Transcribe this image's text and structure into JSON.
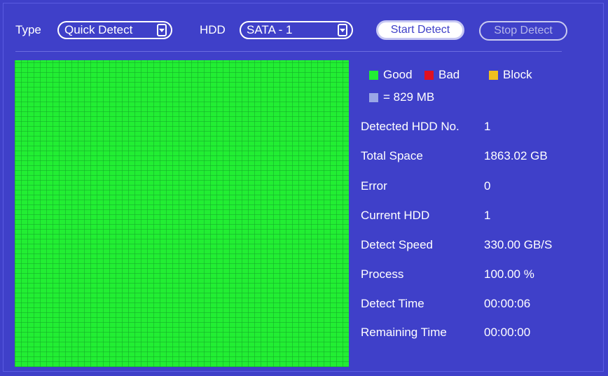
{
  "toolbar": {
    "type_label": "Type",
    "type_value": "Quick Detect",
    "hdd_label": "HDD",
    "hdd_value": "SATA - 1",
    "start_label": "Start Detect",
    "stop_label": "Stop Detect"
  },
  "legend": {
    "good": "Good",
    "bad": "Bad",
    "block": "Block",
    "unit": "= 829 MB",
    "colors": {
      "good": "#22ee33",
      "bad": "#e01020",
      "block": "#f0c020",
      "unit": "#9aa6e6"
    }
  },
  "details": [
    {
      "key": "Detected HDD No.",
      "value": "1"
    },
    {
      "key": "Total Space",
      "value": "1863.02 GB"
    },
    {
      "key": "Error",
      "value": "0"
    },
    {
      "key": "Current HDD",
      "value": "1"
    },
    {
      "key": "Detect Speed",
      "value": "330.00 GB/S"
    },
    {
      "key": "Process",
      "value": "100.00 %"
    },
    {
      "key": "Detect Time",
      "value": "00:00:06"
    },
    {
      "key": "Remaining Time",
      "value": "00:00:00"
    }
  ]
}
